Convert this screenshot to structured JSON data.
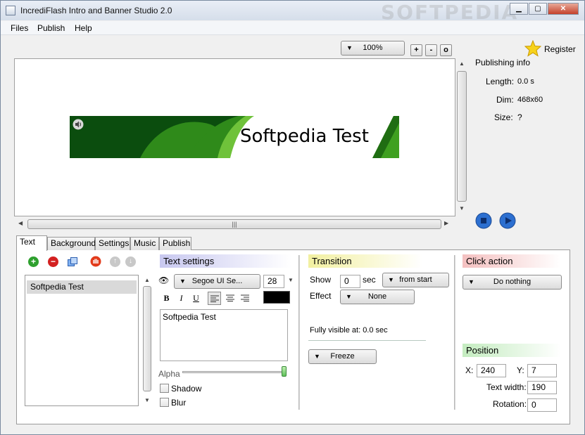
{
  "window": {
    "title": "IncrediFlash Intro and Banner Studio 2.0",
    "watermark": "SOFTPEDIA",
    "minimize": "▁",
    "maximize": "▢",
    "close": "✕"
  },
  "menu": [
    "Files",
    "Publish",
    "Help"
  ],
  "toolbar": {
    "zoom": "100%",
    "zoom_in": "+",
    "zoom_out": "-",
    "zoom_reset": "o",
    "register": "Register"
  },
  "publishing_info": {
    "title": "Publishing info",
    "length_label": "Length:",
    "length_value": "0.0 s",
    "dim_label": "Dim:",
    "dim_value": "468x60",
    "size_label": "Size:",
    "size_value": "?"
  },
  "banner": {
    "text": "Softpedia Test",
    "bg_color": "#0b4d0e",
    "accent_color": "#3fa020"
  },
  "tabs": [
    "Text",
    "Background",
    "Settings",
    "Music",
    "Publish"
  ],
  "text_list": {
    "items": [
      "Softpedia Test"
    ]
  },
  "text_settings": {
    "header": "Text settings",
    "font": "Segoe UI Se...",
    "size": "28",
    "bold": "B",
    "italic": "I",
    "underline": "U",
    "text_value": "Softpedia Test",
    "alpha_label": "Alpha",
    "shadow_label": "Shadow",
    "blur_label": "Blur",
    "color": "#000000"
  },
  "transition": {
    "header": "Transition",
    "show_label": "Show",
    "show_value": "0",
    "sec_label": "sec",
    "from_option": "from start",
    "effect_label": "Effect",
    "effect_value": "None",
    "fully_visible": "Fully visible at: 0.0 sec",
    "freeze_label": "Freeze"
  },
  "click_action": {
    "header": "Click action",
    "value": "Do nothing"
  },
  "position": {
    "header": "Position",
    "x_label": "X:",
    "x_value": "240",
    "y_label": "Y:",
    "y_value": "7",
    "text_width_label": "Text width:",
    "text_width_value": "190",
    "rotation_label": "Rotation:",
    "rotation_value": "0"
  },
  "header_colors": {
    "text_settings": "#c8c8f0",
    "transition": "#f2f0a0",
    "click_action": "#f4c0c0",
    "position": "#c4ecc0"
  }
}
